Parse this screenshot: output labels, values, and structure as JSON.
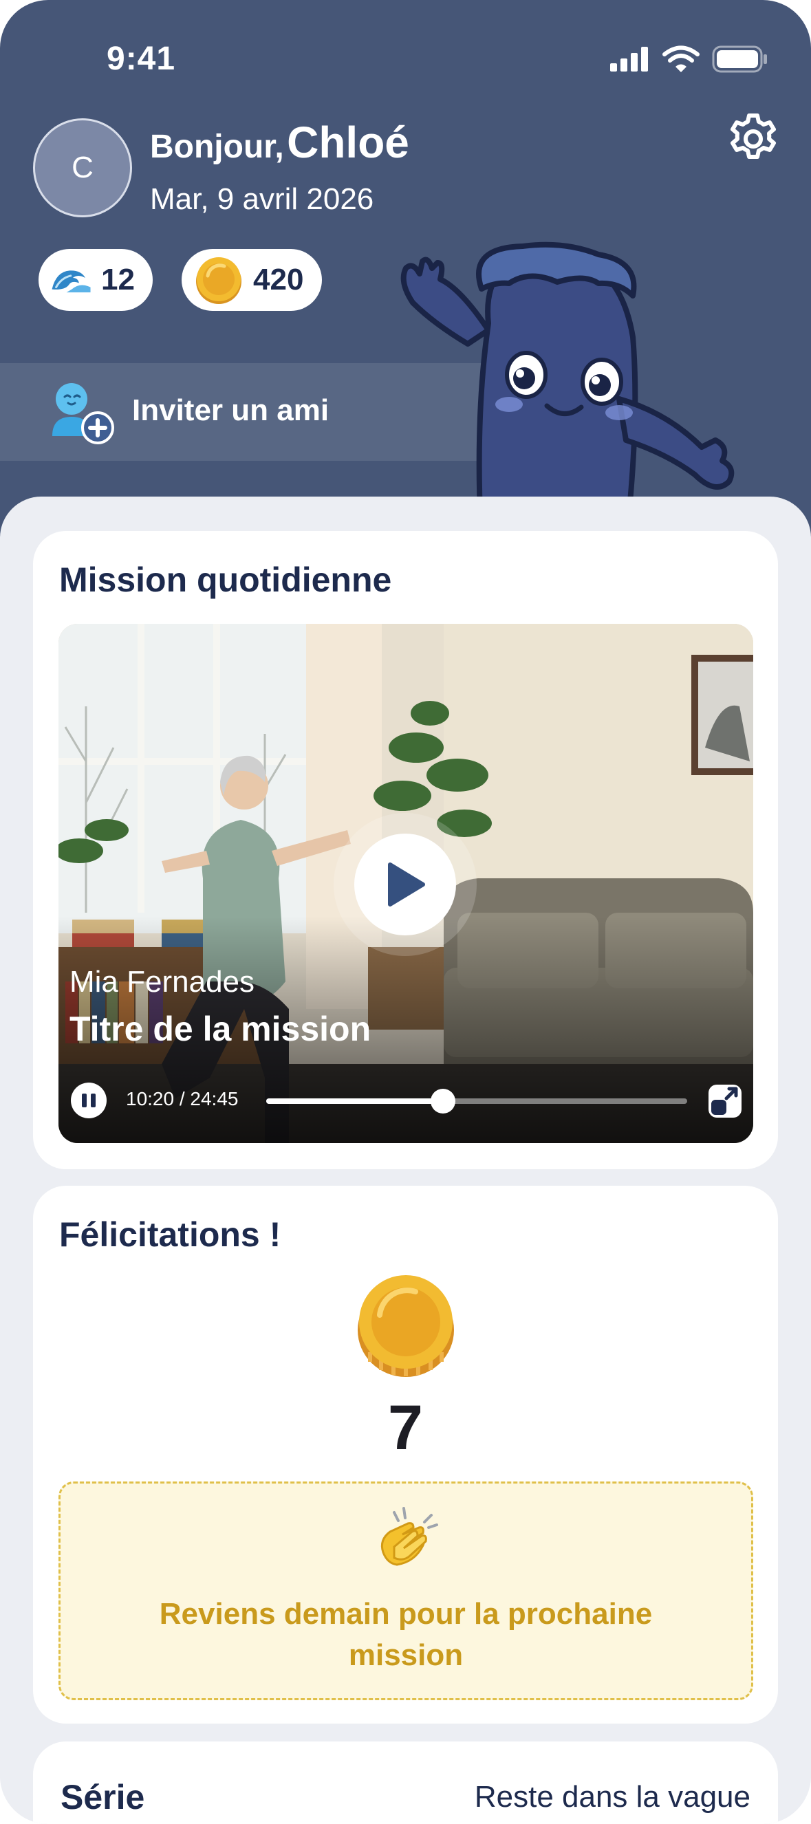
{
  "status_bar": {
    "time": "9:41"
  },
  "header": {
    "avatar_initial": "C",
    "greeting_prefix": "Bonjour,",
    "user_name": "Chloé",
    "date": "Mar, 9 avril 2026",
    "streak_count": "12",
    "coin_count": "420",
    "invite_label": "Inviter un ami"
  },
  "mission": {
    "section_title": "Mission quotidienne",
    "instructor": "Mia Fernades",
    "title": "Titre de la mission",
    "current_time": "10:20",
    "total_time": "24:45",
    "timecode": "10:20 / 24:45",
    "progress": 0.42
  },
  "congrats": {
    "title": "Félicitations !",
    "reward_amount": "7",
    "message": "Reviens demain pour la prochaine mission"
  },
  "series": {
    "title": "Série",
    "link": "Reste dans la vague"
  },
  "colors": {
    "header_bg": "#465677",
    "navy_text": "#1d2a4d",
    "coin_gold": "#f1b730",
    "notice_text": "#c99a1c"
  },
  "icons": [
    "signal-icon",
    "wifi-icon",
    "battery-icon",
    "gear-icon",
    "wave-icon",
    "coin-icon",
    "add-friend-icon",
    "play-icon",
    "pause-icon",
    "fullscreen-icon",
    "clapping-hands-icon"
  ]
}
